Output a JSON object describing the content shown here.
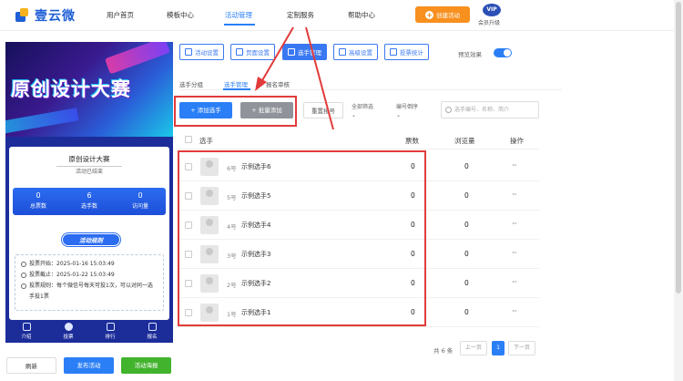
{
  "brand": {
    "name": "壹云微"
  },
  "nav": {
    "items": [
      "用户首页",
      "模板中心",
      "活动管理",
      "定制服务",
      "帮助中心"
    ],
    "active": "活动管理",
    "create_label": "创建活动",
    "vip_badge": "VIP",
    "vip_label": "会员升级"
  },
  "preview": {
    "hero_title": "原创设计大赛",
    "card_title": "原创设计大赛",
    "card_subtitle": "活动已结束",
    "stats": [
      {
        "value": "0",
        "label": "总票数"
      },
      {
        "value": "6",
        "label": "选手数"
      },
      {
        "value": "0",
        "label": "访问量"
      }
    ],
    "rules_button": "活动规则",
    "rules": [
      "投票开始：2025-01-16 15:03:49",
      "投票截止：2025-01-22 15:03:49",
      "投票规则：每个微信号每天可投1次，可以对同一选手投1票"
    ],
    "tabs": [
      "介绍",
      "投票",
      "排行",
      "报名"
    ],
    "active_tab": "投票"
  },
  "bottom_buttons": {
    "refresh": "刷新",
    "publish": "发布活动",
    "poster": "活动海报"
  },
  "toolbar": {
    "buttons": [
      "活动设置",
      "页面设置",
      "选手管理",
      "高级设置",
      "投票统计"
    ],
    "active": "选手管理",
    "preview_label": "预览效果",
    "preview_on": true
  },
  "subtabs": {
    "items": [
      "选手分组",
      "选手管理",
      "报名审核"
    ],
    "active": "选手管理"
  },
  "actions": {
    "add": "添加选手",
    "batch": "批量添加",
    "reset": "重置排号",
    "filter": "全部筛选",
    "sort": "编号倒序",
    "search_placeholder": "选手编号、名称、简介"
  },
  "table": {
    "headers": [
      "选手",
      "票数",
      "浏览量",
      "操作"
    ],
    "rows": [
      {
        "no": "6号",
        "name": "示例选手6",
        "votes": "0",
        "views": "0",
        "ops": "···"
      },
      {
        "no": "5号",
        "name": "示例选手5",
        "votes": "0",
        "views": "0",
        "ops": "···"
      },
      {
        "no": "4号",
        "name": "示例选手4",
        "votes": "0",
        "views": "0",
        "ops": "···"
      },
      {
        "no": "3号",
        "name": "示例选手3",
        "votes": "0",
        "views": "0",
        "ops": "···"
      },
      {
        "no": "2号",
        "name": "示例选手2",
        "votes": "0",
        "views": "0",
        "ops": "···"
      },
      {
        "no": "1号",
        "name": "示例选手1",
        "votes": "0",
        "views": "0",
        "ops": "···"
      }
    ]
  },
  "pagination": {
    "total": "共 6 条",
    "prev": "上一页",
    "page": "1",
    "next": "下一页"
  },
  "colors": {
    "accent": "#2a7ff6",
    "orange": "#f7901e",
    "highlight": "#e23b3b"
  }
}
